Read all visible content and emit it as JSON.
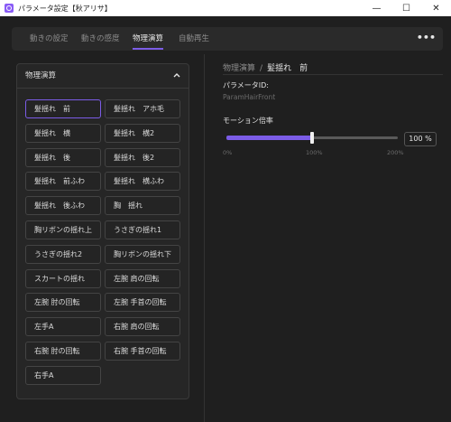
{
  "window": {
    "title": "パラメータ設定【秋アリサ】",
    "controls": {
      "minimize": "—",
      "maximize": "☐",
      "close": "✕"
    }
  },
  "tabs": [
    {
      "label": "動きの設定",
      "active": false
    },
    {
      "label": "動きの感度",
      "active": false
    },
    {
      "label": "物理演算",
      "active": true
    },
    {
      "label": "自動再生",
      "active": false
    }
  ],
  "more_label": "•••",
  "panel": {
    "title": "物理演算",
    "collapse_icon": "chevron-up-icon",
    "items": [
      {
        "label": "髪揺れ　前",
        "selected": true
      },
      {
        "label": "髪揺れ　アホ毛",
        "selected": false
      },
      {
        "label": "髪揺れ　横",
        "selected": false
      },
      {
        "label": "髪揺れ　横2",
        "selected": false
      },
      {
        "label": "髪揺れ　後",
        "selected": false
      },
      {
        "label": "髪揺れ　後2",
        "selected": false
      },
      {
        "label": "髪揺れ　前ふわ",
        "selected": false
      },
      {
        "label": "髪揺れ　横ふわ",
        "selected": false
      },
      {
        "label": "髪揺れ　後ふわ",
        "selected": false
      },
      {
        "label": "胸　揺れ",
        "selected": false
      },
      {
        "label": "胸リボンの揺れ上",
        "selected": false
      },
      {
        "label": "うさぎの揺れ1",
        "selected": false
      },
      {
        "label": "うさぎの揺れ2",
        "selected": false
      },
      {
        "label": "胸リボンの揺れ下",
        "selected": false
      },
      {
        "label": "スカートの揺れ",
        "selected": false
      },
      {
        "label": "左腕 肩の回転",
        "selected": false
      },
      {
        "label": "左腕 肘の回転",
        "selected": false
      },
      {
        "label": "左腕 手首の回転",
        "selected": false
      },
      {
        "label": "左手A",
        "selected": false
      },
      {
        "label": "右腕 肩の回転",
        "selected": false
      },
      {
        "label": "右腕 肘の回転",
        "selected": false
      },
      {
        "label": "右腕 手首の回転",
        "selected": false
      },
      {
        "label": "右手A",
        "selected": false
      }
    ]
  },
  "detail": {
    "breadcrumb_parent": "物理演算",
    "breadcrumb_sep": "/",
    "breadcrumb_current": "髪揺れ　前",
    "param_id_label": "パラメータID:",
    "param_id_value": "ParamHairFront",
    "multiplier_label": "モーション倍率",
    "multiplier_value": "100 %",
    "multiplier_percent": 100,
    "multiplier_max_percent": 200,
    "ticks": [
      "0%",
      "100%",
      "200%"
    ]
  },
  "colors": {
    "accent": "#7b5ce6",
    "background": "#1f1f1f",
    "panel": "#262626"
  }
}
